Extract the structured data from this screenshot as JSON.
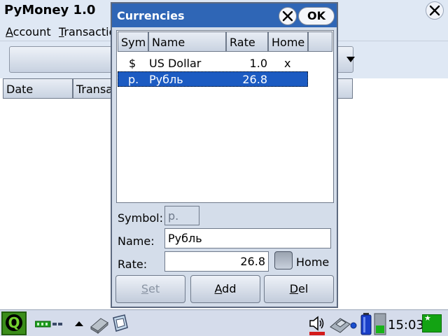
{
  "app": {
    "title": "PyMoney 1.0"
  },
  "menubar": {
    "account": {
      "accel": "A",
      "rest": "ccount"
    },
    "transactions": {
      "accel": "T",
      "rest": "ransactio"
    }
  },
  "transactions_table": {
    "columns": [
      "Date",
      "Transa"
    ]
  },
  "dialog": {
    "title": "Currencies",
    "ok_label": "OK",
    "columns": {
      "sym": "Sym",
      "name": "Name",
      "rate": "Rate",
      "home": "Home"
    },
    "rows": [
      {
        "sym": "$",
        "name": "US Dollar",
        "rate": "1.0",
        "home": "x",
        "selected": false
      },
      {
        "sym": "р.",
        "name": "Рубль",
        "rate": "26.8",
        "home": "",
        "selected": true
      }
    ],
    "form": {
      "symbol_label": "Symbol:",
      "symbol_value": "р.",
      "name_label": "Name:",
      "name_value": "Рубль",
      "rate_label": "Rate:",
      "rate_value": "26.8",
      "home_label": "Home",
      "home_checked": false
    },
    "buttons": {
      "set": {
        "accel": "S",
        "rest": "et",
        "enabled": false
      },
      "add": {
        "accel": "A",
        "rest": "dd",
        "enabled": true
      },
      "del": {
        "accel": "D",
        "rest": "el",
        "enabled": true
      }
    }
  },
  "taskbar": {
    "clock": "15:03",
    "icons": [
      "start-menu-icon",
      "network-icon",
      "up-arrow-icon",
      "drive-icon",
      "app-window-icon",
      "volume-icon",
      "pc-card-icon",
      "battery-icon",
      "signal-icon",
      "language-flag-icon"
    ]
  },
  "colors": {
    "dialog_title": "#2f66b6",
    "selection": "#1c5bc2",
    "start_button": "#3a8d1a",
    "window_bg": "#dfe8f4"
  }
}
